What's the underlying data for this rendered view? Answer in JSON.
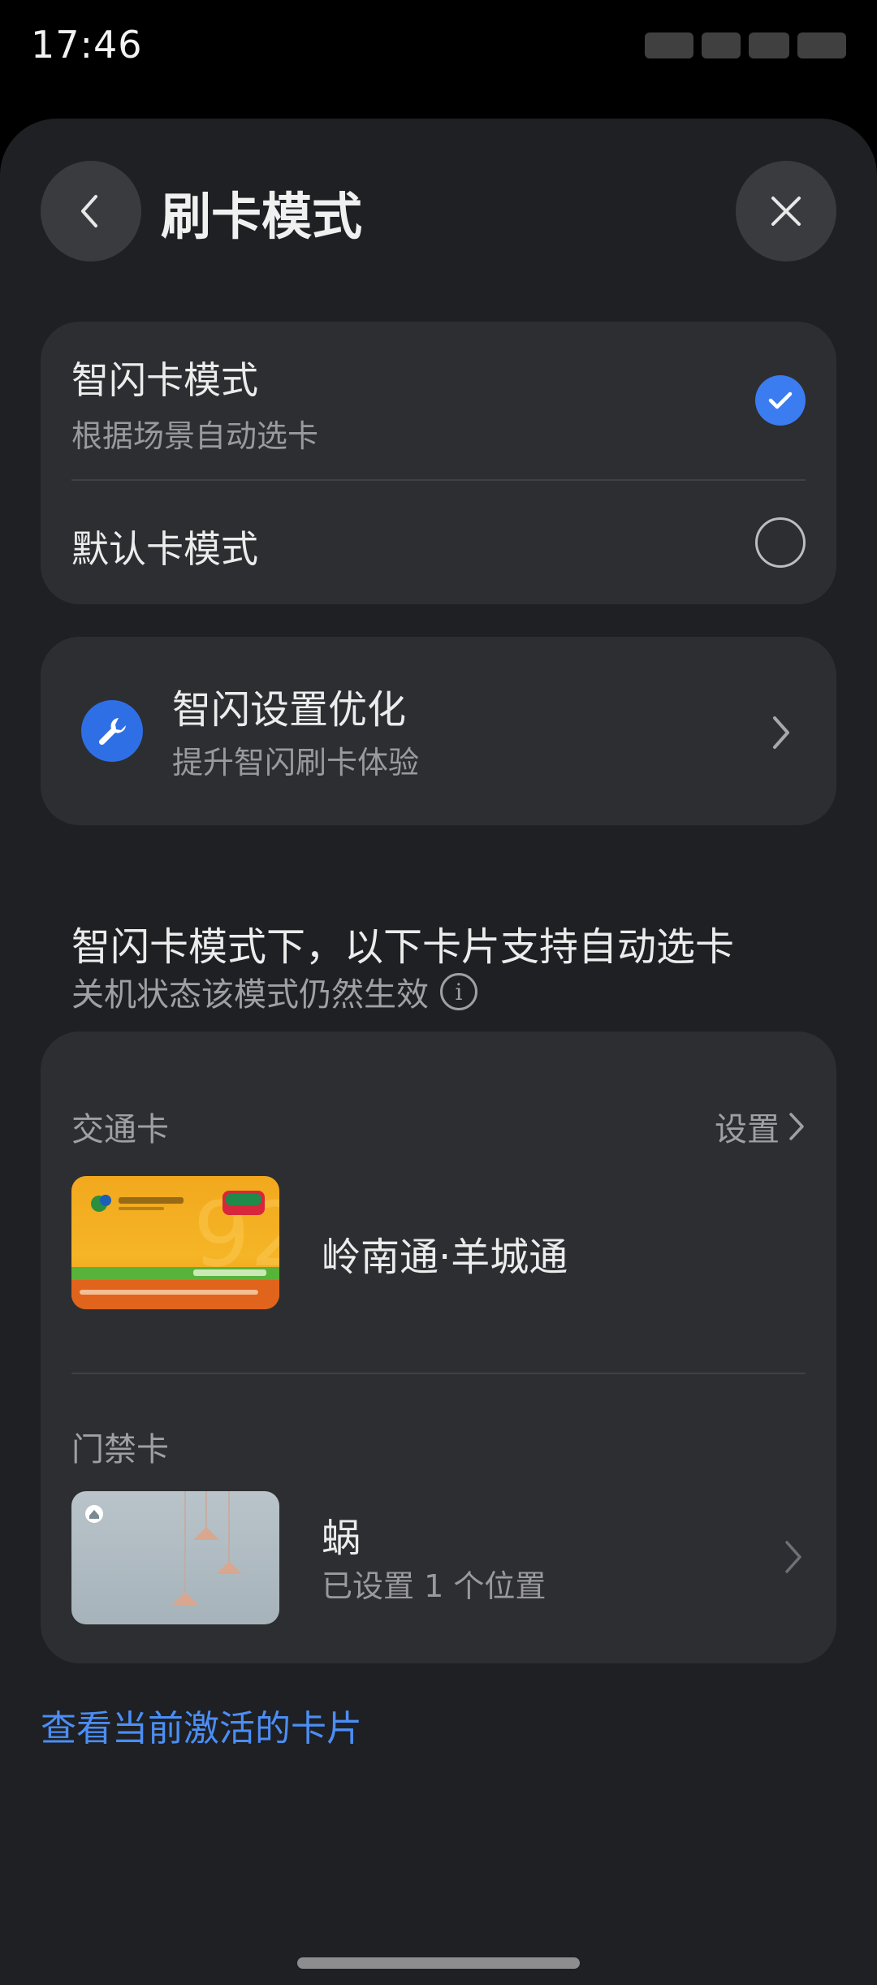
{
  "status_bar": {
    "time": "17:46"
  },
  "header": {
    "title": "刷卡模式"
  },
  "modes": [
    {
      "title": "智闪卡模式",
      "subtitle": "根据场景自动选卡",
      "selected": true
    },
    {
      "title": "默认卡模式",
      "subtitle": "",
      "selected": false
    }
  ],
  "optimize": {
    "title": "智闪设置优化",
    "subtitle": "提升智闪刷卡体验",
    "icon": "wrench-icon"
  },
  "section": {
    "title": "智闪卡模式下，以下卡片支持自动选卡",
    "subtitle": "关机状态该模式仍然生效",
    "info_icon": "i"
  },
  "transit": {
    "label": "交通卡",
    "settings_label": "设置",
    "card_name": "岭南通·羊城通"
  },
  "access": {
    "label": "门禁卡",
    "card_name": "蜗",
    "card_sub": "已设置 1 个位置"
  },
  "footer_link": "查看当前激活的卡片",
  "colors": {
    "accent": "#3b7cf0",
    "link": "#4b8ef5",
    "card_bg": "#2d2e32",
    "sheet_bg": "#1f2023"
  }
}
